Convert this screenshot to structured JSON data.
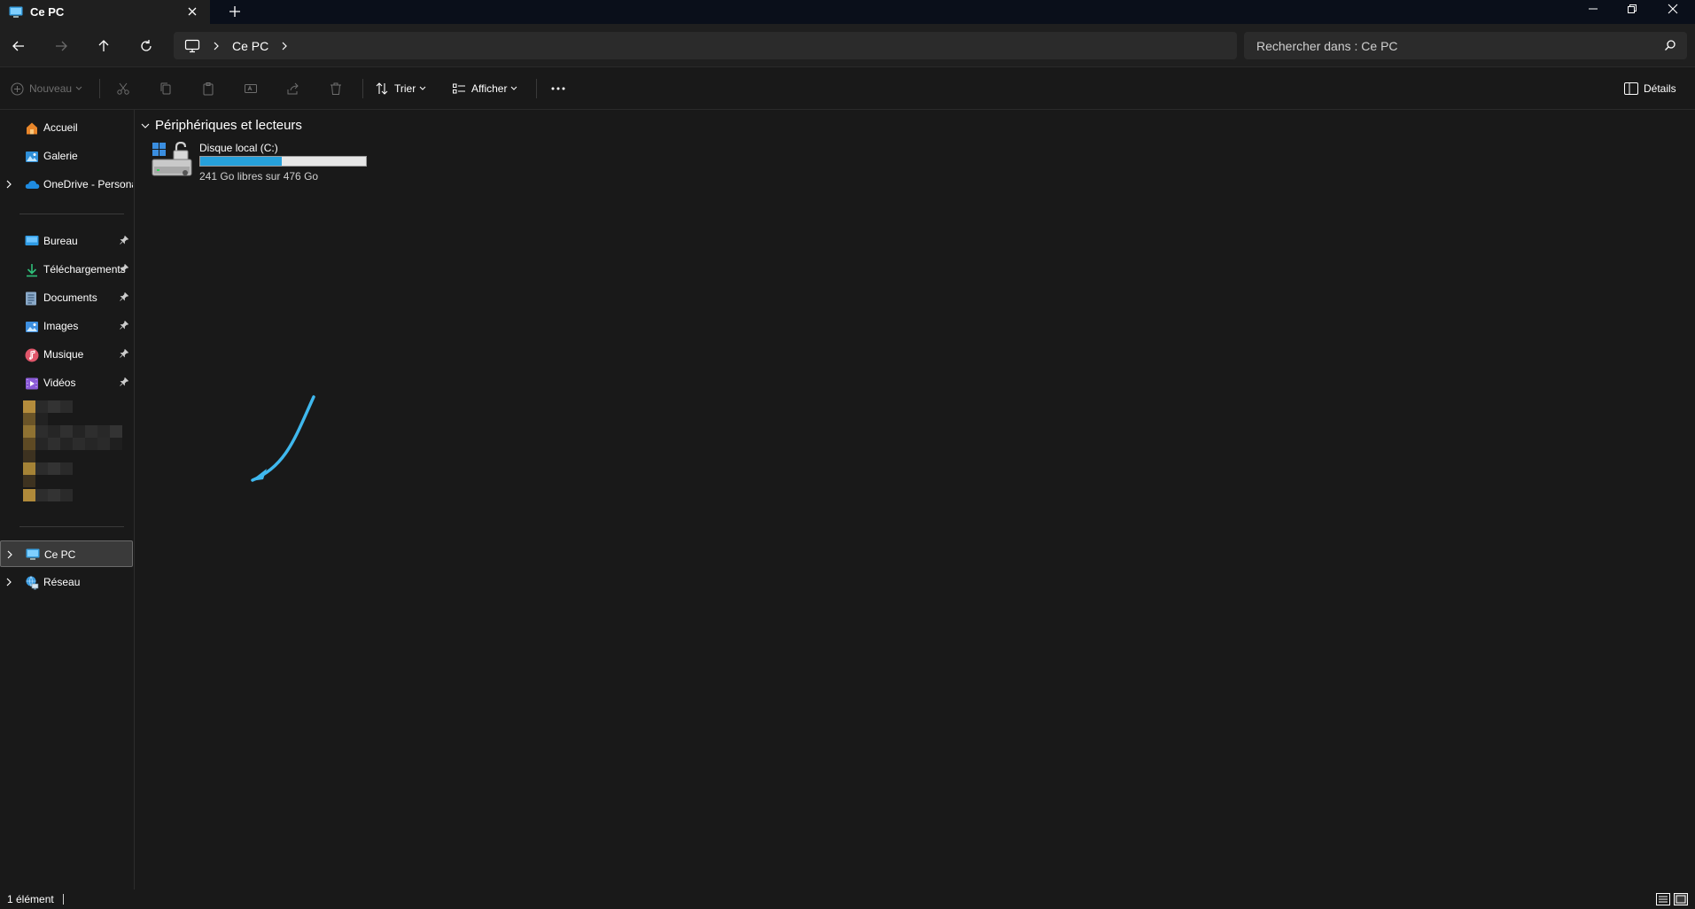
{
  "window": {
    "tab_title": "Ce PC",
    "controls": [
      "minimize",
      "restore",
      "close"
    ]
  },
  "address": {
    "breadcrumb": [
      "Ce PC"
    ],
    "search_placeholder": "Rechercher dans : Ce PC"
  },
  "commands": {
    "new_label": "Nouveau",
    "sort_label": "Trier",
    "view_label": "Afficher",
    "details_label": "Détails",
    "more_label": "..."
  },
  "sidebar": {
    "top_items": [
      {
        "label": "Accueil",
        "icon": "home-icon"
      },
      {
        "label": "Galerie",
        "icon": "gallery-icon"
      },
      {
        "label": "OneDrive - Personal",
        "icon": "onedrive-icon"
      }
    ],
    "quick_access": [
      {
        "label": "Bureau",
        "icon": "desktop-folder-icon"
      },
      {
        "label": "Téléchargements",
        "icon": "downloads-icon"
      },
      {
        "label": "Documents",
        "icon": "documents-icon"
      },
      {
        "label": "Images",
        "icon": "pictures-icon"
      },
      {
        "label": "Musique",
        "icon": "music-icon"
      },
      {
        "label": "Vidéos",
        "icon": "videos-icon"
      }
    ],
    "bottom_items": [
      {
        "label": "Ce PC",
        "icon": "this-pc-icon",
        "selected": true
      },
      {
        "label": "Réseau",
        "icon": "network-icon"
      }
    ]
  },
  "content": {
    "group_title": "Périphériques et lecteurs",
    "drives": [
      {
        "name": "Disque local (C:)",
        "free_text": "241 Go libres sur 476 Go",
        "used_fraction": 0.494
      }
    ]
  },
  "status": {
    "item_count": "1 élément"
  },
  "colors": {
    "accent": "#26a0da",
    "annotation_arrow": "#3fb8ee",
    "background": "#191919"
  }
}
